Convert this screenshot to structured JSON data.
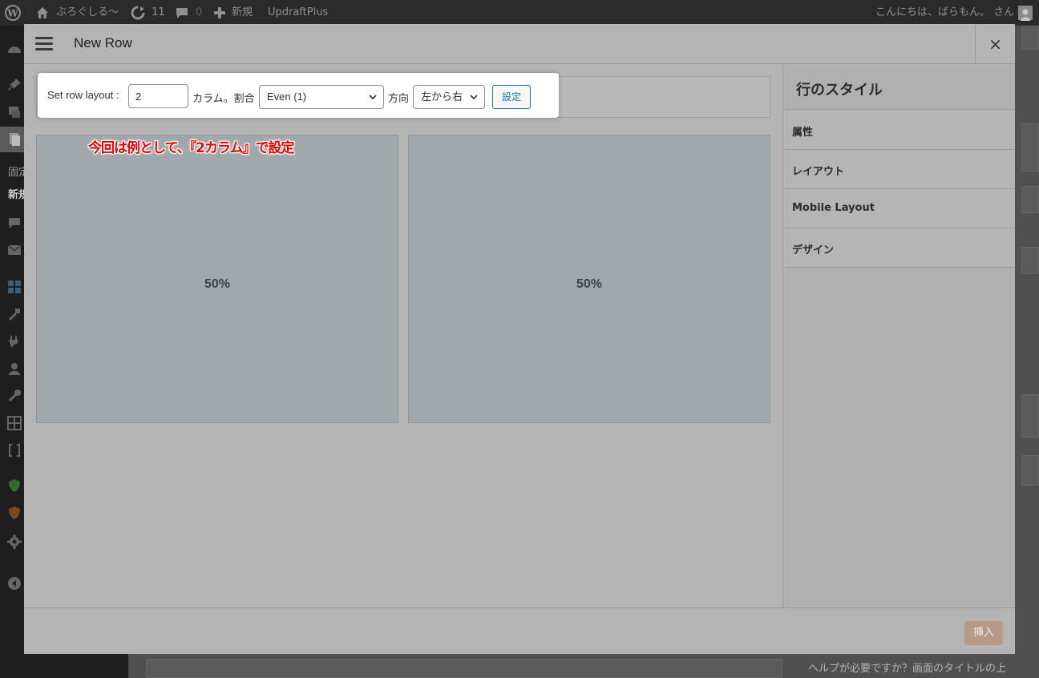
{
  "adminbar": {
    "site_name": "ぶろぐしる〜",
    "updates_count": "11",
    "comments_count": "0",
    "new_label": "新規",
    "plugin_label": "UpdraftPlus",
    "greeting": "こんにちは、ばらもん。 さん"
  },
  "adminmenu": {
    "partial_labels": [
      "固定",
      "新規"
    ]
  },
  "modal": {
    "title": "New Row",
    "close_label": "×"
  },
  "toolbar": {
    "set_layout_label": "Set row layout :",
    "columns_value": "2",
    "columns_label": "カラム。割合",
    "ratio_selected": "Even (1)",
    "direction_label": "方向",
    "direction_selected": "左から右",
    "set_button": "設定"
  },
  "cells": [
    {
      "label": "50%"
    },
    {
      "label": "50%"
    }
  ],
  "annotation": "今回は例として、『2カラム』で設定",
  "sidebar": {
    "title": "行のスタイル",
    "items": [
      {
        "label": "属性"
      },
      {
        "label": "レイアウト"
      },
      {
        "label": "Mobile Layout"
      },
      {
        "label": "デザイン"
      }
    ]
  },
  "footer": {
    "insert_button": "挿入"
  },
  "background": {
    "help_text": "ヘルプが必要ですか？画面のタイトルの上"
  },
  "colors": {
    "accent": "#2271b1",
    "annotation": "#e00000",
    "insert_button": "#b59a88"
  }
}
